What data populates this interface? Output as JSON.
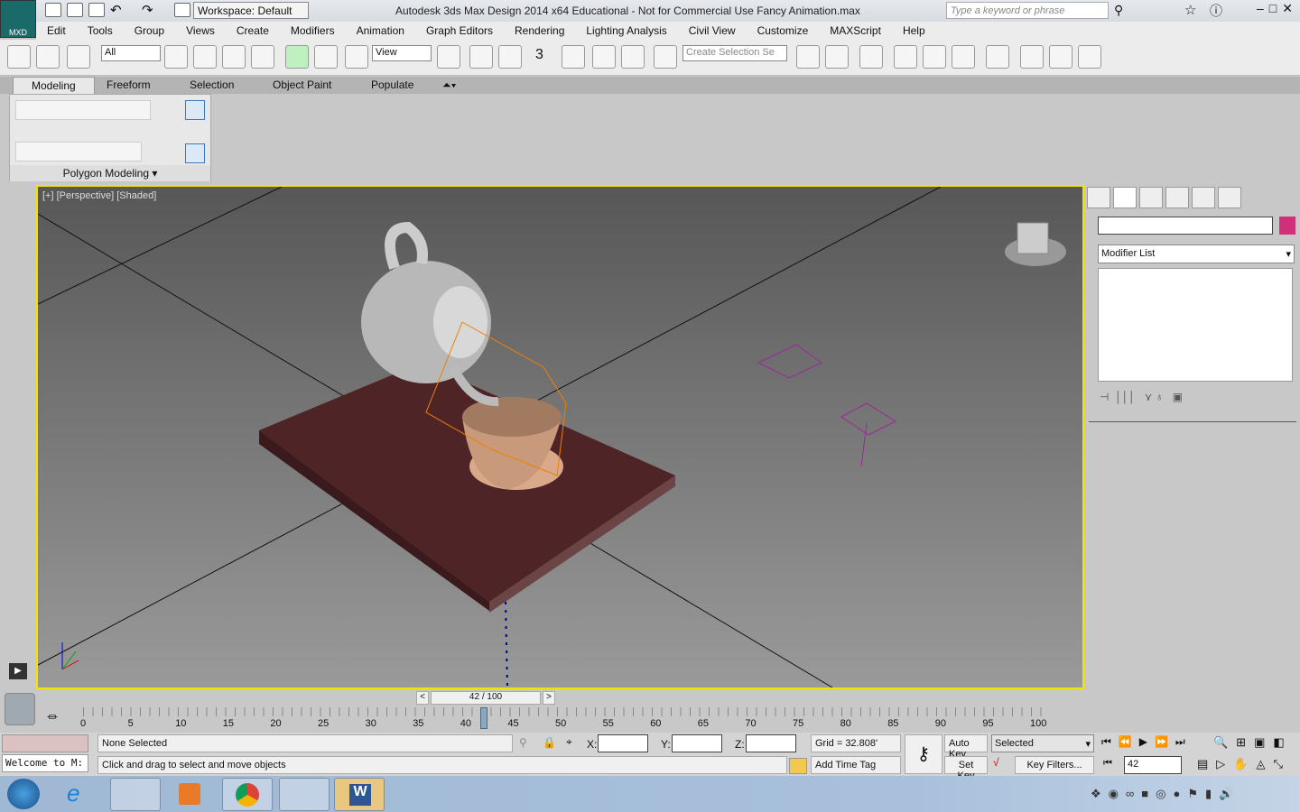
{
  "app": {
    "logo": "MXD",
    "workspace": "Workspace: Default",
    "title": "Autodesk 3ds Max Design 2014 x64    Educational - Not for Commercial Use    Fancy Animation.max",
    "search_placeholder": "Type a keyword or phrase"
  },
  "menu": [
    "Edit",
    "Tools",
    "Group",
    "Views",
    "Create",
    "Modifiers",
    "Animation",
    "Graph Editors",
    "Rendering",
    "Lighting Analysis",
    "Civil View",
    "Customize",
    "MAXScript",
    "Help"
  ],
  "toolbar": {
    "filter": "All",
    "ref_coord": "View",
    "selection_set_placeholder": "Create Selection Se",
    "snap_label": "3"
  },
  "ribbon": {
    "tabs": [
      "Modeling",
      "Freeform",
      "Selection",
      "Object Paint",
      "Populate"
    ],
    "active": "Modeling",
    "panel_label": "Polygon Modeling"
  },
  "viewport": {
    "label": "[+] [Perspective] [Shaded]",
    "accent": "#f0e400"
  },
  "command_panel": {
    "name_value": "",
    "modifier_list": "Modifier List",
    "color_swatch": "#d0307a"
  },
  "timeline": {
    "frame_display": "42 / 100",
    "current": 42,
    "max": 100,
    "ticks": [
      "0",
      "5",
      "10",
      "15",
      "20",
      "25",
      "30",
      "35",
      "40",
      "45",
      "50",
      "55",
      "60",
      "65",
      "70",
      "75",
      "80",
      "85",
      "90",
      "95",
      "100"
    ]
  },
  "status": {
    "welcome": "Welcome to M:",
    "selection": "None Selected",
    "prompt": "Click and drag to select and move objects",
    "x_label": "X:",
    "y_label": "Y:",
    "z_label": "Z:",
    "grid": "Grid = 32.808'",
    "add_time_tag": "Add Time Tag",
    "auto_key": "Auto Key",
    "set_key": "Set Key",
    "key_mode": "Selected",
    "key_filters": "Key Filters...",
    "frame": "42"
  }
}
